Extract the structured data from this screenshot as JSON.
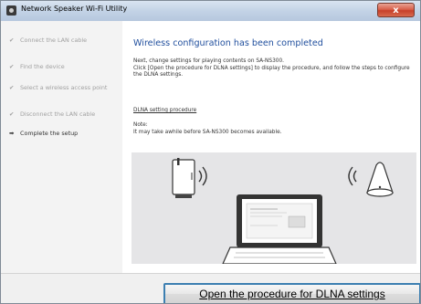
{
  "window": {
    "title": "Network Speaker Wi-Fi Utility",
    "close_label": "x"
  },
  "sidebar": {
    "steps": [
      {
        "mark": "✔",
        "label": "Connect the LAN cable"
      },
      {
        "mark": "✔",
        "label": "Find the device"
      },
      {
        "mark": "✔",
        "label": "Select a wireless access point"
      },
      {
        "mark": "✔",
        "label": "Disconnect the LAN cable"
      },
      {
        "mark": "➡",
        "label": "Complete the setup"
      }
    ]
  },
  "main": {
    "heading": "Wireless configuration has been completed",
    "instructions": [
      "Next, change settings for playing contents on SA-NS300.",
      "Click [Open the procedure for DLNA settings] to display the procedure, and follow the steps to configure the DLNA settings."
    ],
    "link_label": "DLNA setting procedure",
    "note_label": "Note:",
    "note_text": "It may take awhile before SA-NS300 becomes available."
  },
  "footer": {
    "open_procedure_label": "Open the procedure for DLNA settings"
  },
  "colors": {
    "heading": "#1f4e9d",
    "button_focus_border": "#3c7fb1"
  },
  "icons": [
    "router-icon",
    "wifi-signal-icon",
    "speaker-icon",
    "laptop-icon"
  ]
}
